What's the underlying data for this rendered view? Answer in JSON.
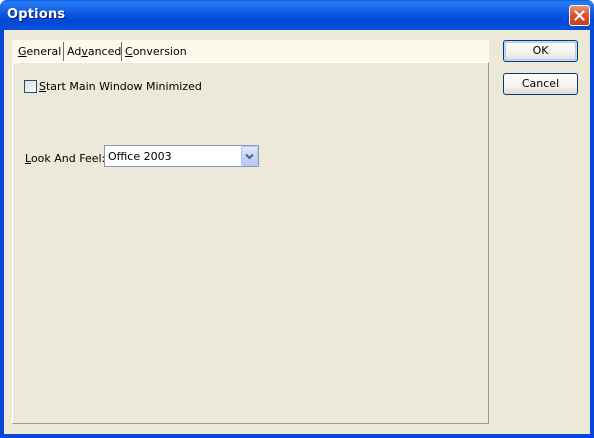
{
  "window": {
    "title": "Options"
  },
  "tabs": [
    {
      "label_mnemonic": "G",
      "label_rest": "eneral",
      "selected": true
    },
    {
      "label_pre": "Ad",
      "label_mnemonic": "v",
      "label_rest": "anced",
      "selected": false
    },
    {
      "label_mnemonic": "C",
      "label_rest": "onversion",
      "selected": false
    }
  ],
  "general": {
    "start_minimized": {
      "label_mnemonic": "S",
      "label_rest": "tart Main Window Minimized",
      "checked": false
    },
    "look_and_feel": {
      "label_mnemonic": "L",
      "label_rest": "ook And Feel:",
      "value": "Office 2003"
    }
  },
  "buttons": {
    "ok": "OK",
    "cancel": "Cancel"
  },
  "colors": {
    "titlebar": "#0a58e0",
    "client_bg": "#ece9d8",
    "tab_strip_bg": "#fcfaec",
    "close_button": "#d8542f"
  },
  "icons": {
    "close": "close-icon",
    "dropdown": "chevron-down-icon"
  }
}
